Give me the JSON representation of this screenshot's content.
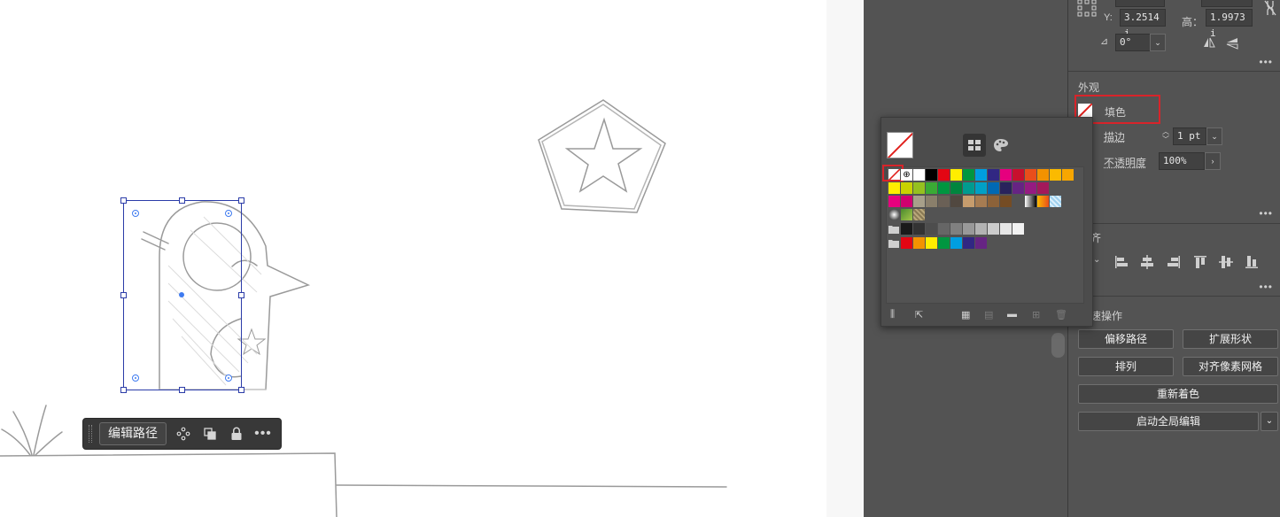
{
  "taskbar": {
    "edit_path_label": "编辑路径"
  },
  "transform": {
    "y_label": "Y:",
    "y_value": "3.2514 i",
    "h_label": "高：",
    "h_value": "1.9973 i",
    "angle_value": "0°"
  },
  "appearance": {
    "title": "外观",
    "fill_label": "填色",
    "stroke_label": "描边",
    "stroke_value": "1 pt",
    "opacity_label": "不透明度",
    "opacity_value": "100%"
  },
  "align": {
    "title_fragment": "齐"
  },
  "quick_actions": {
    "title_fragment": "速操作",
    "offset_path": "偏移路径",
    "expand_shape": "扩展形状",
    "arrange": "排列",
    "align_pixel_grid": "对齐像素网格",
    "recolor": "重新着色",
    "global_edit": "启动全局编辑"
  },
  "colors": {
    "accent_highlight": "#d8242a",
    "selection": "#2b3ca8",
    "panel_bg": "#535353"
  },
  "swatches": {
    "row1": [
      "#ffffff",
      "#000000",
      "#e30613",
      "#ffed00",
      "#00963f",
      "#009ee0",
      "#312783",
      "#e6007e",
      "#c8102e",
      "#e94e1b",
      "#f39200",
      "#fbba00",
      "#f7a600"
    ],
    "row2": [
      "#ffed00",
      "#c9d200",
      "#95c11f",
      "#3aaa35",
      "#009640",
      "#00853e",
      "#009b8f",
      "#00a0c6",
      "#0069b4",
      "#29235c",
      "#662483",
      "#951b81",
      "#a3195b"
    ],
    "row3": [
      "#e6007e",
      "#d0006f",
      "#a8a08a",
      "#8a7f6b",
      "#6a6056",
      "#514840",
      "#c69c6d",
      "#a67c52",
      "#8c6239",
      "#754c24",
      "#603913",
      "#42210b",
      "#fbb03b"
    ],
    "grays": [
      "#1a1a1a",
      "#333333",
      "#4d4d4d",
      "#666666",
      "#808080",
      "#999999",
      "#b3b3b3",
      "#cccccc",
      "#e6e6e6",
      "#f2f2f2"
    ],
    "group": [
      "#e30613",
      "#f39200",
      "#ffed00",
      "#009640",
      "#009ee0",
      "#312783",
      "#662483"
    ]
  }
}
